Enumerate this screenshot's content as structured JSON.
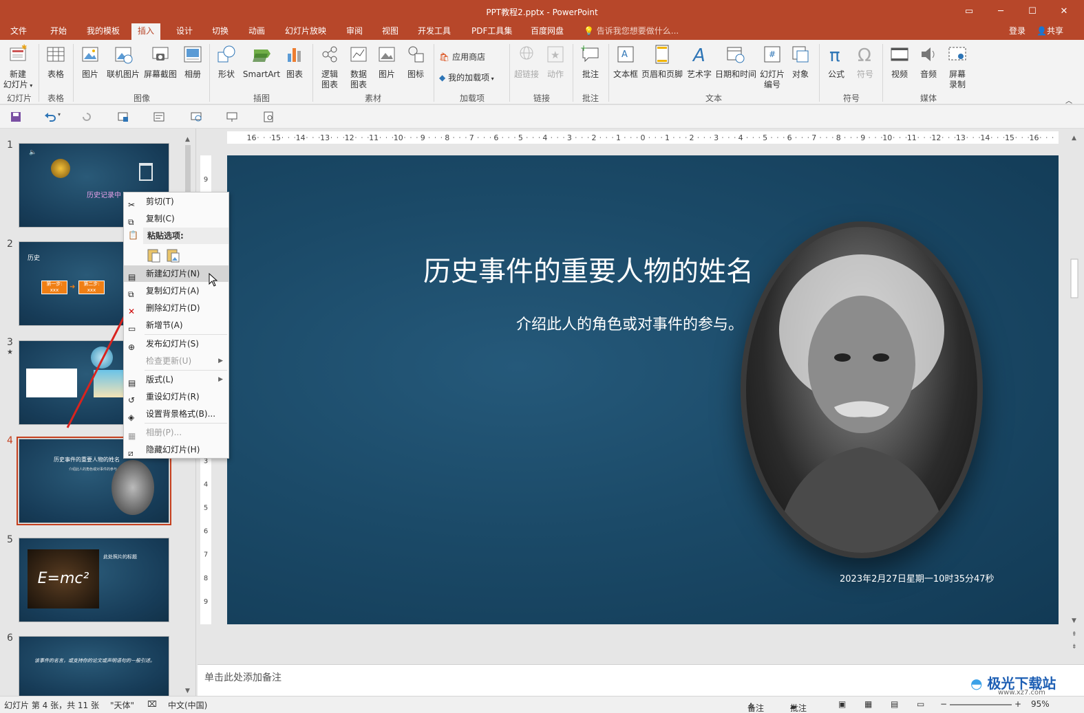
{
  "window": {
    "title": "PPT教程2.pptx - PowerPoint"
  },
  "menu": {
    "tabs": [
      "文件",
      "开始",
      "我的模板",
      "插入",
      "设计",
      "切换",
      "动画",
      "幻灯片放映",
      "审阅",
      "视图",
      "开发工具",
      "PDF工具集",
      "百度网盘"
    ],
    "active_tab": "插入",
    "tell_me": "告诉我您想要做什么...",
    "login": "登录",
    "share": "共享"
  },
  "ribbon": {
    "new_slide": "新建\n幻灯片",
    "table": "表格",
    "picture": "图片",
    "online_picture": "联机图片",
    "screenshot": "屏幕截图",
    "album": "相册",
    "shapes": "形状",
    "smartart": "SmartArt",
    "chart": "图表",
    "logic_chart": "逻辑\n图表",
    "data_chart": "数据\n图表",
    "material_picture": "图片",
    "icon": "图标",
    "app_store": "应用商店",
    "my_addins": "我的加载项",
    "hyperlink": "超链接",
    "action": "动作",
    "comment": "批注",
    "textbox": "文本框",
    "header_footer": "页眉和页脚",
    "wordart": "艺术字",
    "datetime": "日期和时间",
    "slide_number": "幻灯片\n编号",
    "object": "对象",
    "equation": "公式",
    "symbol": "符号",
    "video": "视频",
    "audio": "音频",
    "screen_record": "屏幕\n录制",
    "groups": {
      "slides": "幻灯片",
      "tables": "表格",
      "images": "图像",
      "illustrations": "插图",
      "material": "素材",
      "addins": "加载项",
      "links": "链接",
      "comments": "批注",
      "text": "文本",
      "symbols": "符号",
      "media": "媒体"
    }
  },
  "thumbnails": {
    "numbers": [
      "1",
      "2",
      "3",
      "4",
      "5",
      "6"
    ],
    "star": "★",
    "slide1_title": "历史记录中",
    "slide2_label": "历史",
    "slide2_steps": [
      "第一步:",
      "第二步:"
    ],
    "slide2_step_sub": "xxx",
    "slide4_title": "历史事件的重要人物的姓名",
    "slide4_sub": "介绍此人的角色或对事件的参与。",
    "slide5_formula": "E=mc²",
    "slide5_title": "此处照片的标题",
    "slide6_text": "该事件的名言，或支持你的论文或声明语句的一般引述。"
  },
  "context_menu": {
    "cut": "剪切(T)",
    "copy": "复制(C)",
    "paste_options": "粘贴选项:",
    "new_slide": "新建幻灯片(N)",
    "duplicate_slide": "复制幻灯片(A)",
    "delete_slide": "删除幻灯片(D)",
    "add_section": "新增节(A)",
    "publish_slides": "发布幻灯片(S)",
    "check_updates": "检查更新(U)",
    "layout": "版式(L)",
    "reset_slide": "重设幻灯片(R)",
    "format_background": "设置背景格式(B)...",
    "photo_album": "相册(P)...",
    "hide_slide": "隐藏幻灯片(H)"
  },
  "slide": {
    "title": "历史事件的重要人物的姓名",
    "subtitle": "介绍此人的角色或对事件的参与。",
    "datetime": "2023年2月27日星期一10时35分47秒"
  },
  "ruler": {
    "h_labels": [
      "16",
      "15",
      "14",
      "13",
      "12",
      "11",
      "10",
      "9",
      "8",
      "7",
      "6",
      "5",
      "4",
      "3",
      "2",
      "1",
      "0",
      "1",
      "2",
      "3",
      "4",
      "5",
      "6",
      "7",
      "8",
      "9",
      "10",
      "11",
      "12",
      "13",
      "14",
      "15",
      "16"
    ],
    "v_labels": [
      "9",
      "8",
      "7",
      "6",
      "5",
      "4",
      "3",
      "2",
      "1",
      "0",
      "1",
      "2",
      "3",
      "4",
      "5",
      "6",
      "7",
      "8",
      "9"
    ]
  },
  "notes": {
    "placeholder": "单击此处添加备注"
  },
  "status": {
    "slide_info": "幻灯片 第 4 张，共 11 张",
    "theme": "\"天体\"",
    "language": "中文(中国)",
    "notes": "备注",
    "comments": "批注",
    "zoom": "95%"
  },
  "watermark": {
    "brand": "极光下载站",
    "url": "www.xz7.com"
  },
  "colors": {
    "accent": "#b7472a",
    "slide_bg": "#1b4a68",
    "selected": "#c43e1c",
    "arrow": "#d9231e"
  }
}
